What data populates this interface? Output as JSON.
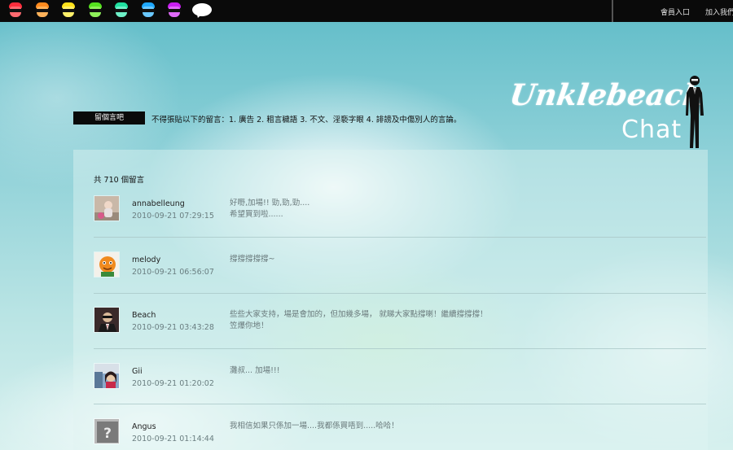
{
  "header": {
    "icons": [
      {
        "name": "red-head-icon",
        "hair": "#ff2d3c",
        "face": "#ff6a70"
      },
      {
        "name": "orange-head-icon",
        "hair": "#ff8a1e",
        "face": "#ffb25a"
      },
      {
        "name": "yellow-head-icon",
        "hair": "#ffe21a",
        "face": "#fff06a"
      },
      {
        "name": "green-head-icon",
        "hair": "#55e01e",
        "face": "#8ff05a"
      },
      {
        "name": "teal-head-icon",
        "hair": "#20e0a0",
        "face": "#6ef0c8"
      },
      {
        "name": "blue-head-icon",
        "hair": "#1ea8ff",
        "face": "#6ac8ff"
      },
      {
        "name": "purple-head-icon",
        "hair": "#c81ef0",
        "face": "#e06af8"
      }
    ],
    "login_label": "會員入口",
    "join_label": "加入我們"
  },
  "title": {
    "tag_label": "留個言吧",
    "rules": "不得張貼以下的留言：1. 廣告 2. 粗言穢語 3. 不文、淫褻字眼 4. 誹謗及中傷別人的言論。"
  },
  "logo": {
    "script": "Unklebeach",
    "chat": "Chat"
  },
  "guestbook": {
    "count_label": "共 710 個留言",
    "entries": [
      {
        "user": "annabelleung",
        "time": "2010-09-21 07:29:15",
        "lines": [
          "好嘢,加場!! 勁,勁,勁....",
          "希望買到啦......"
        ],
        "avatar": "girl"
      },
      {
        "user": "melody",
        "time": "2010-09-21 06:56:07",
        "lines": [
          "撐撐撐撐撐~"
        ],
        "avatar": "cartoon"
      },
      {
        "user": "Beach",
        "time": "2010-09-21 03:43:28",
        "lines": [
          "些些大家支持，場是會加的，但加幾多場， 就睇大家點撐喇！繼續撐撐撐！",
          "笠爆你地！"
        ],
        "avatar": "man"
      },
      {
        "user": "Gii",
        "time": "2010-09-21 01:20:02",
        "lines": [
          "灘叔... 加場!!!"
        ],
        "avatar": "selfie"
      },
      {
        "user": "Angus",
        "time": "2010-09-21 01:14:44",
        "lines": [
          "我相信如果只係加一場....我都係買唔到.....哈哈！"
        ],
        "avatar": "placeholder"
      }
    ]
  }
}
